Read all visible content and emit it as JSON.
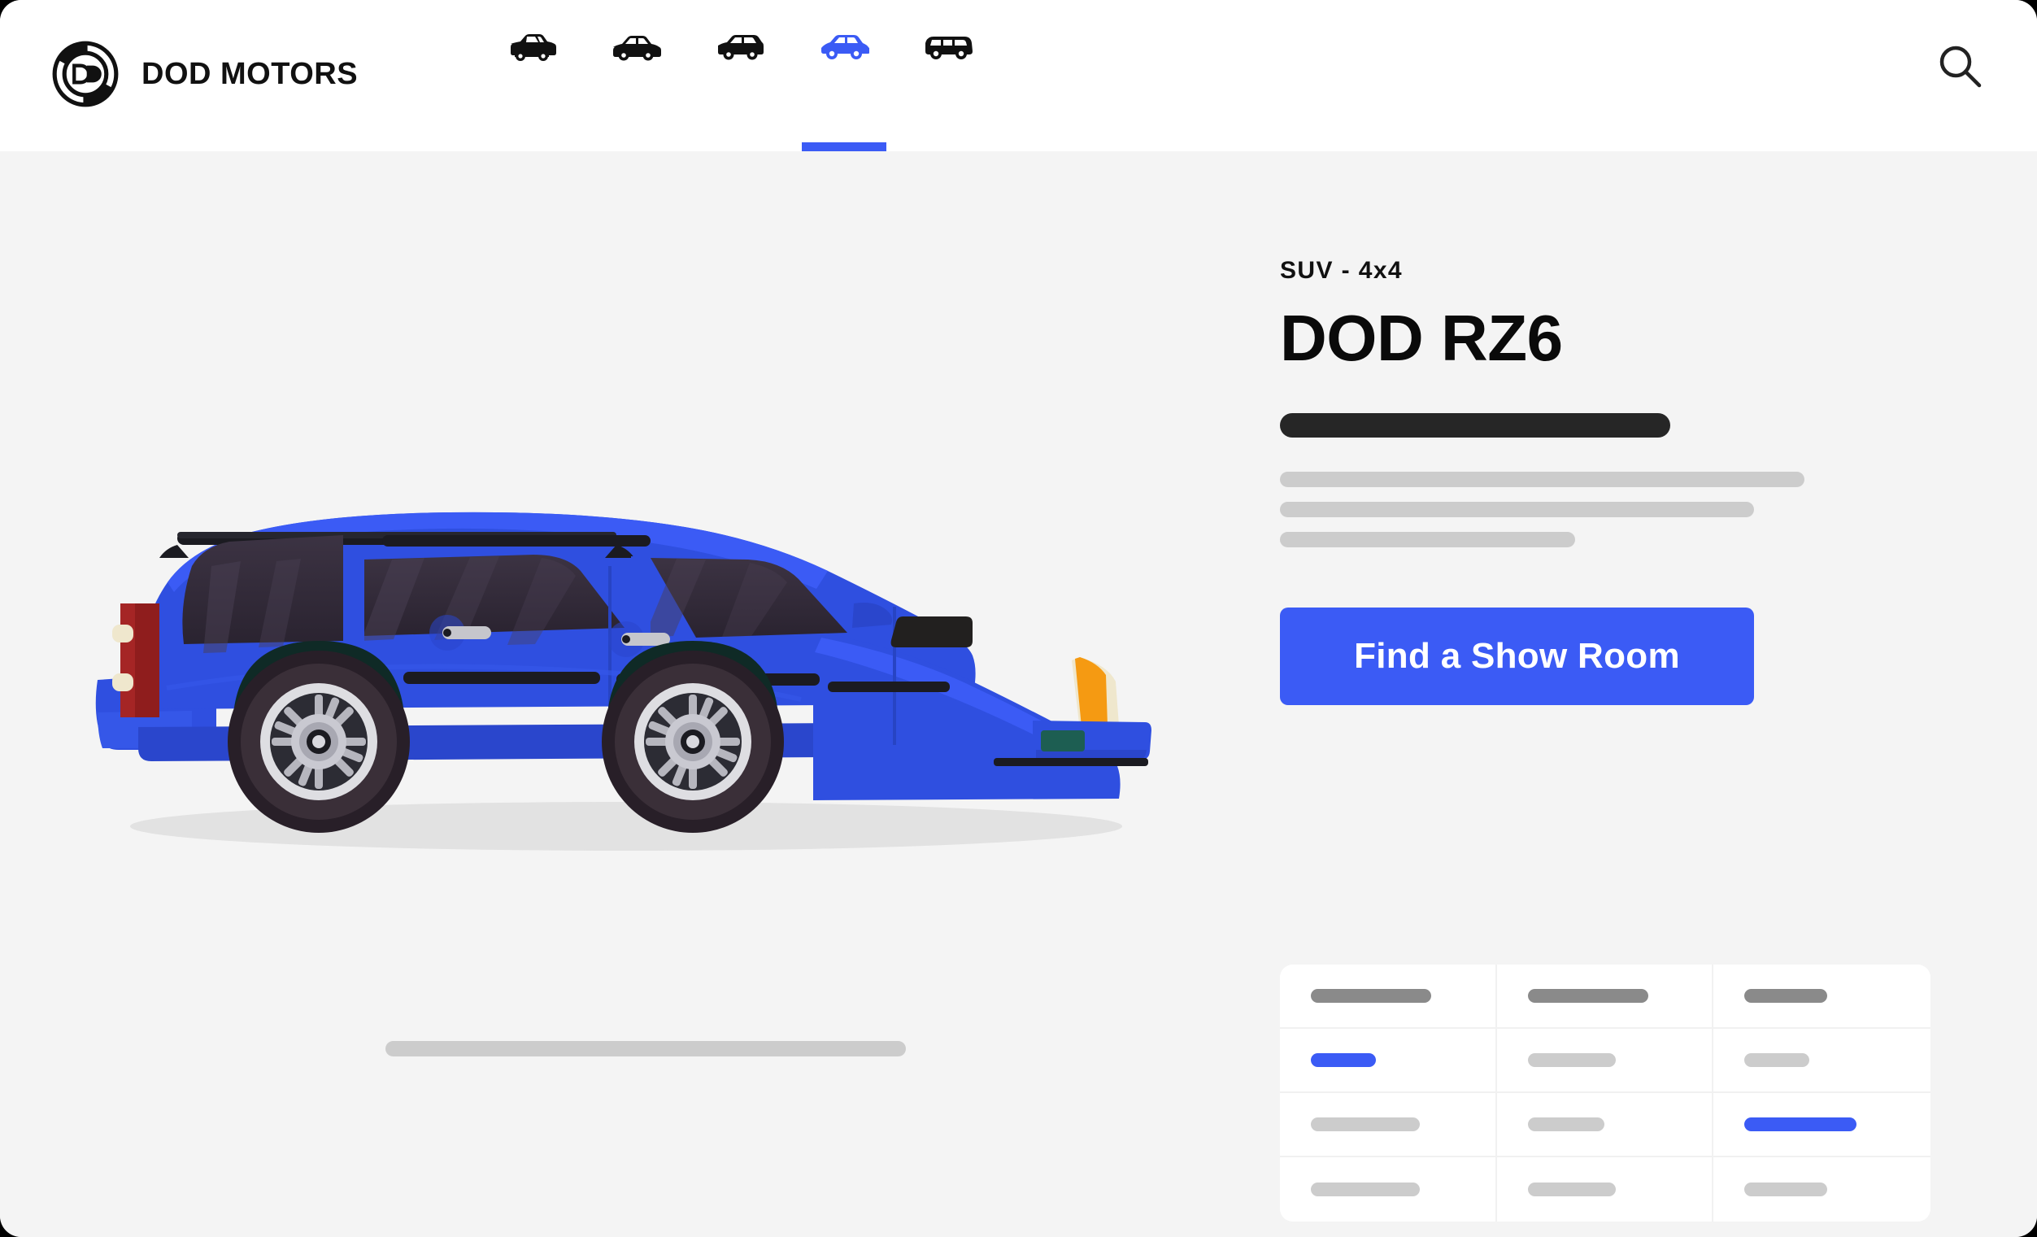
{
  "brand": {
    "name": "DOD MOTORS",
    "logo_icon": "dod-circular-emblem-icon",
    "logo_letters": "DD"
  },
  "header": {
    "search_icon": "search-icon",
    "nav_items": [
      {
        "icon": "coupe-car-icon",
        "label": "Coupe",
        "active": false
      },
      {
        "icon": "sedan-car-icon",
        "label": "Sedan",
        "active": false
      },
      {
        "icon": "hatchback-car-icon",
        "label": "Hatchback",
        "active": false
      },
      {
        "icon": "suv-car-icon",
        "label": "SUV",
        "active": true
      },
      {
        "icon": "van-car-icon",
        "label": "Van",
        "active": false
      }
    ]
  },
  "hero": {
    "vehicle_illustration": "blue-suv-side-view-illustration",
    "caption_placeholder": "caption-skeleton-bar"
  },
  "detail": {
    "eyebrow": "SUV - 4x4",
    "title": "DOD RZ6",
    "subtitle_placeholder": "subtitle-skeleton-bar",
    "description_placeholders": [
      "line-1",
      "line-2",
      "line-3"
    ],
    "cta_label": "Find a Show Room"
  },
  "spec_table": {
    "rows": [
      [
        {
          "style": "head",
          "width": 148
        },
        {
          "style": "head",
          "width": 148
        },
        {
          "style": "head",
          "width": 102
        }
      ],
      [
        {
          "style": "accent",
          "width": 80
        },
        {
          "style": "normal",
          "width": 108
        },
        {
          "style": "normal",
          "width": 80
        }
      ],
      [
        {
          "style": "normal",
          "width": 134
        },
        {
          "style": "normal",
          "width": 94
        },
        {
          "style": "accent",
          "width": 138
        }
      ],
      [
        {
          "style": "normal",
          "width": 134
        },
        {
          "style": "normal",
          "width": 108
        },
        {
          "style": "normal",
          "width": 102
        }
      ]
    ]
  },
  "colors": {
    "accent_blue": "#3b5bf5",
    "page_background": "#f4f4f4",
    "header_background": "#ffffff",
    "text_dark": "#111111",
    "skeleton_gray": "#cccccc",
    "skeleton_dark_gray": "#8a8a8a",
    "car_body_blue": "#2f4fe0"
  }
}
